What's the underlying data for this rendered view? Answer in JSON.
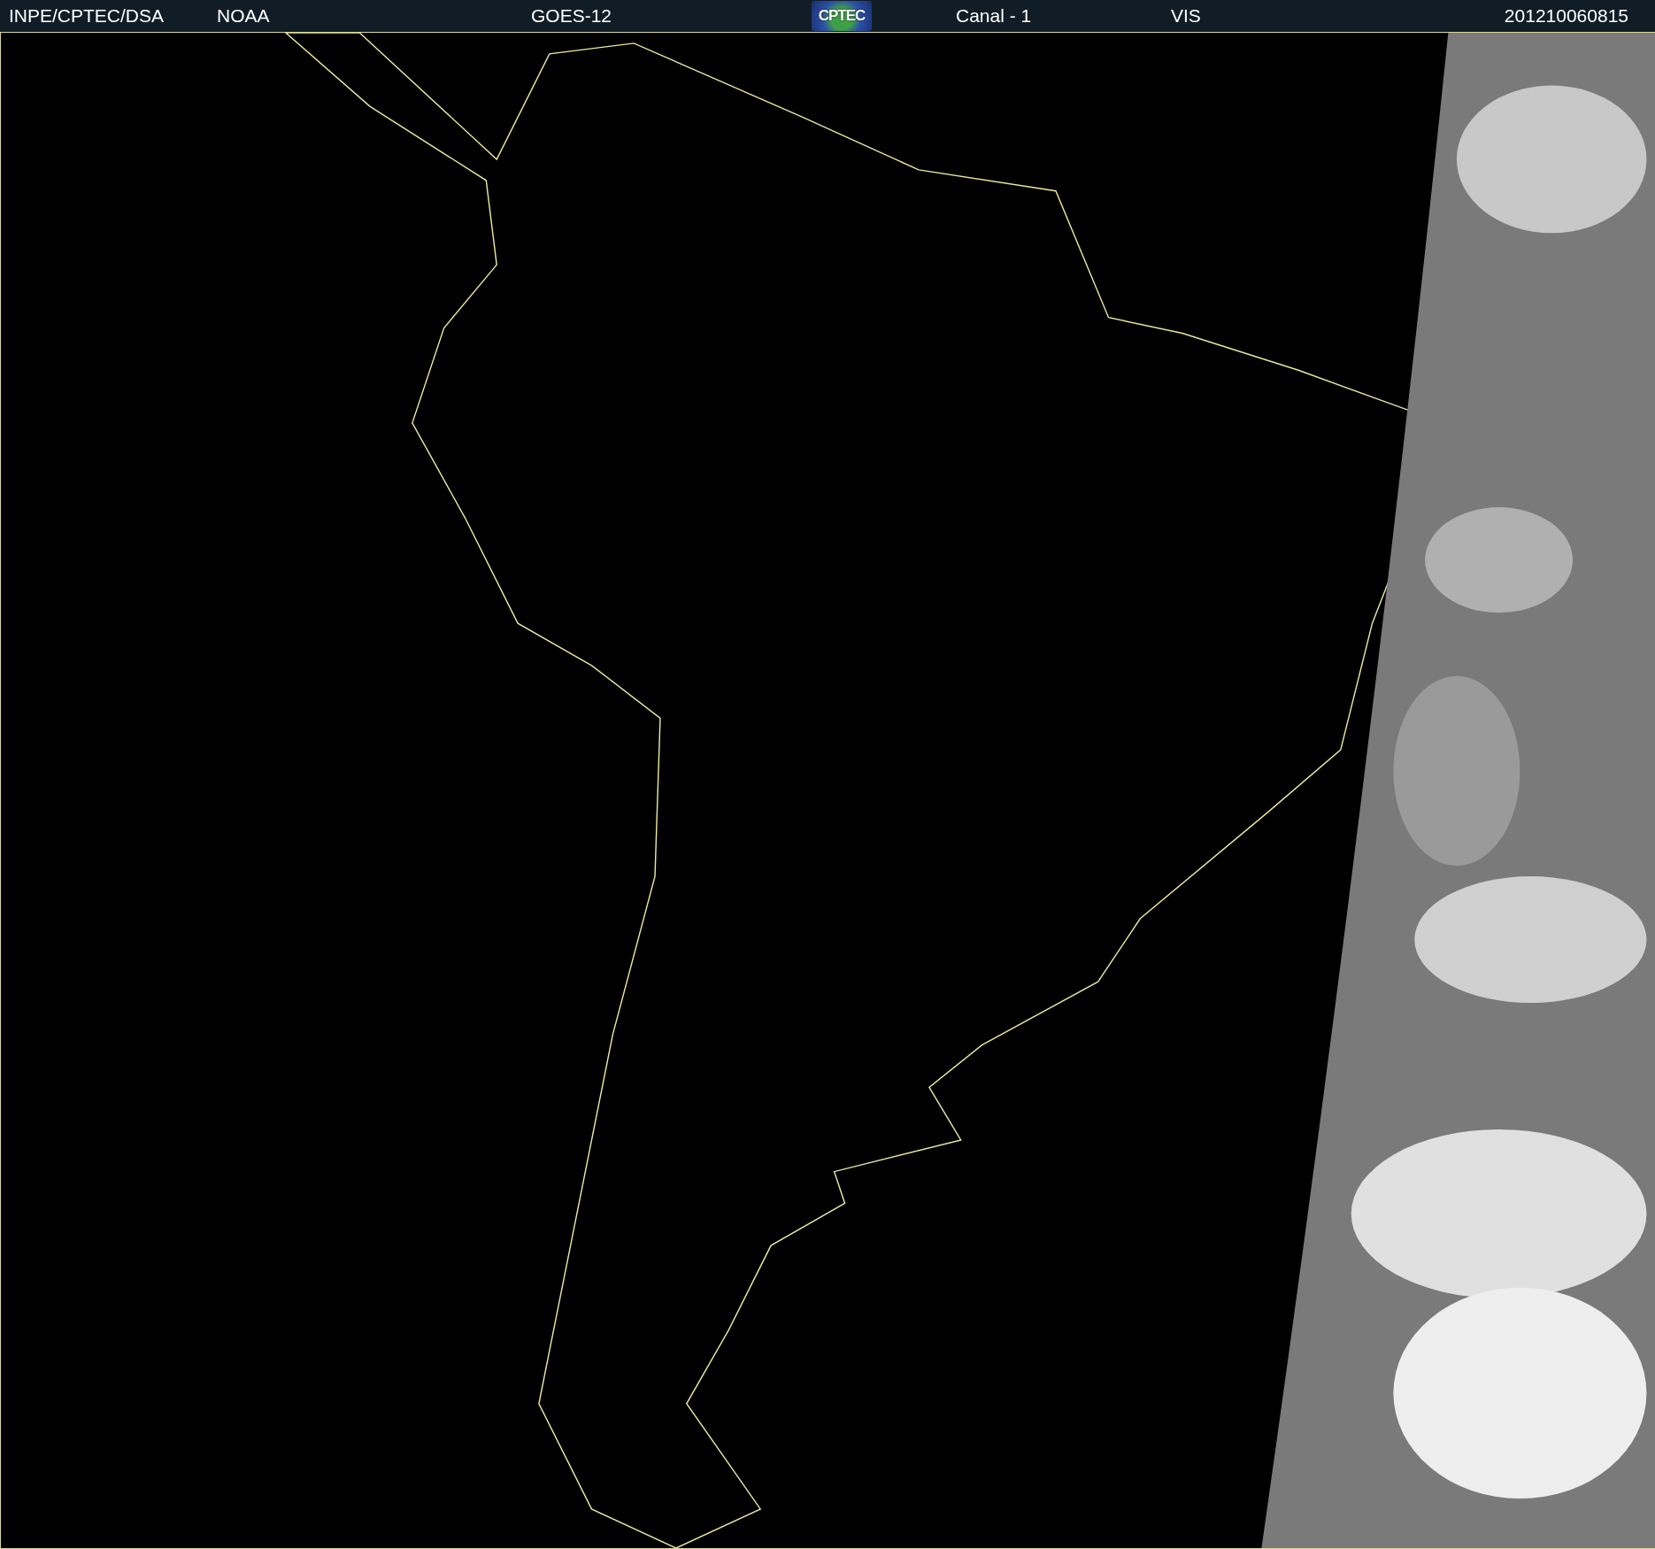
{
  "header": {
    "items": [
      {
        "kind": "text",
        "text": "INPE/CPTEC/DSA"
      },
      {
        "kind": "text",
        "text": "NOAA"
      },
      {
        "kind": "text",
        "text": "GOES-12"
      },
      {
        "kind": "logo",
        "text": "CPTEC"
      },
      {
        "kind": "text",
        "text": "Canal - 1"
      },
      {
        "kind": "text",
        "text": "VIS"
      },
      {
        "kind": "text",
        "text": "201210060815"
      }
    ]
  }
}
